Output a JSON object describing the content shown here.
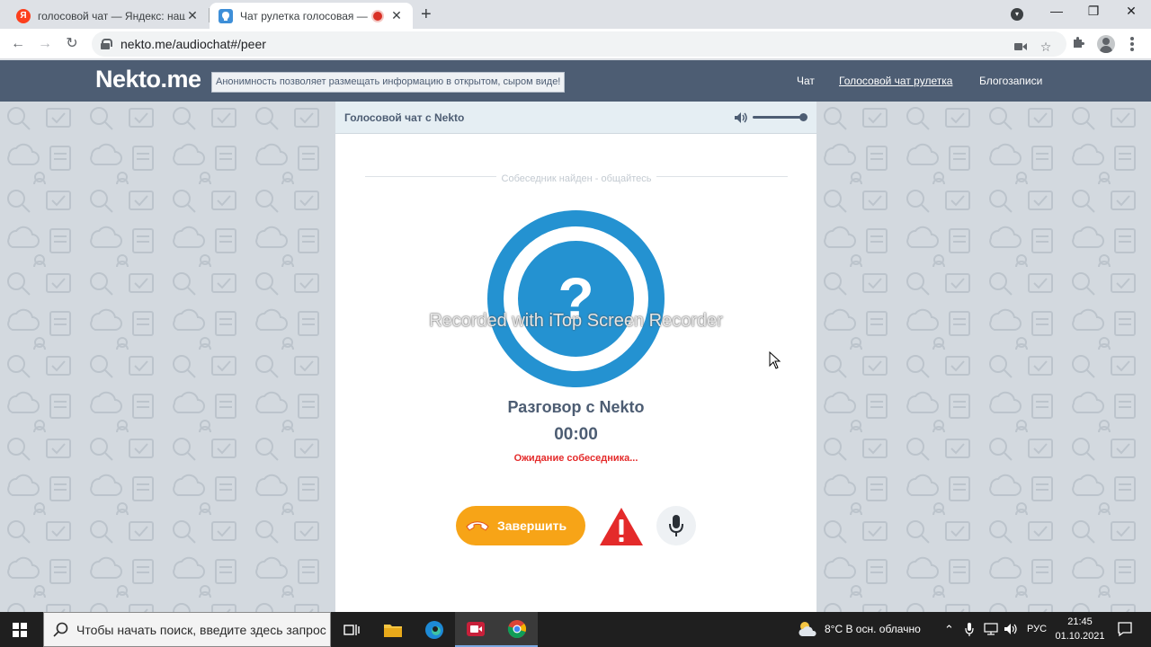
{
  "browser": {
    "tabs": [
      {
        "title": "голосовой чат — Яндекс: нашлось",
        "favicon": "yandex-icon",
        "active": false
      },
      {
        "title": "Чат рулетка голосовая — Nekto",
        "favicon": "nekto-icon",
        "active": true,
        "recording": true
      }
    ],
    "url": "nekto.me/audiochat#/peer"
  },
  "site": {
    "logo": "Nekto.me",
    "tagline": "Анонимность позволяет размещать информацию в открытом, сыром виде!",
    "nav": [
      {
        "label": "Чат"
      },
      {
        "label": "Голосовой чат рулетка"
      },
      {
        "label": "Блогозаписи"
      }
    ]
  },
  "chat": {
    "header_title": "Голосовой чат с Nekto",
    "volume_level": 1.0,
    "status_divider": "Собеседник найден - общайтесь",
    "avatar_symbol": "?",
    "conversation_title": "Разговор с Nekto",
    "timer": "00:00",
    "waiting_text": "Ожидание собеседника...",
    "end_button_label": "Завершить",
    "colors": {
      "accent": "#2492d1",
      "end_button": "#f7a417",
      "warning": "#e42a2a",
      "header": "#4d5d73"
    }
  },
  "watermark": "Recorded with iTop Screen Recorder",
  "taskbar": {
    "search_placeholder": "Чтобы начать поиск, введите здесь запрос",
    "weather": "8°C  В осн. облачно",
    "language": "РУС",
    "time": "21:45",
    "date": "01.10.2021"
  }
}
